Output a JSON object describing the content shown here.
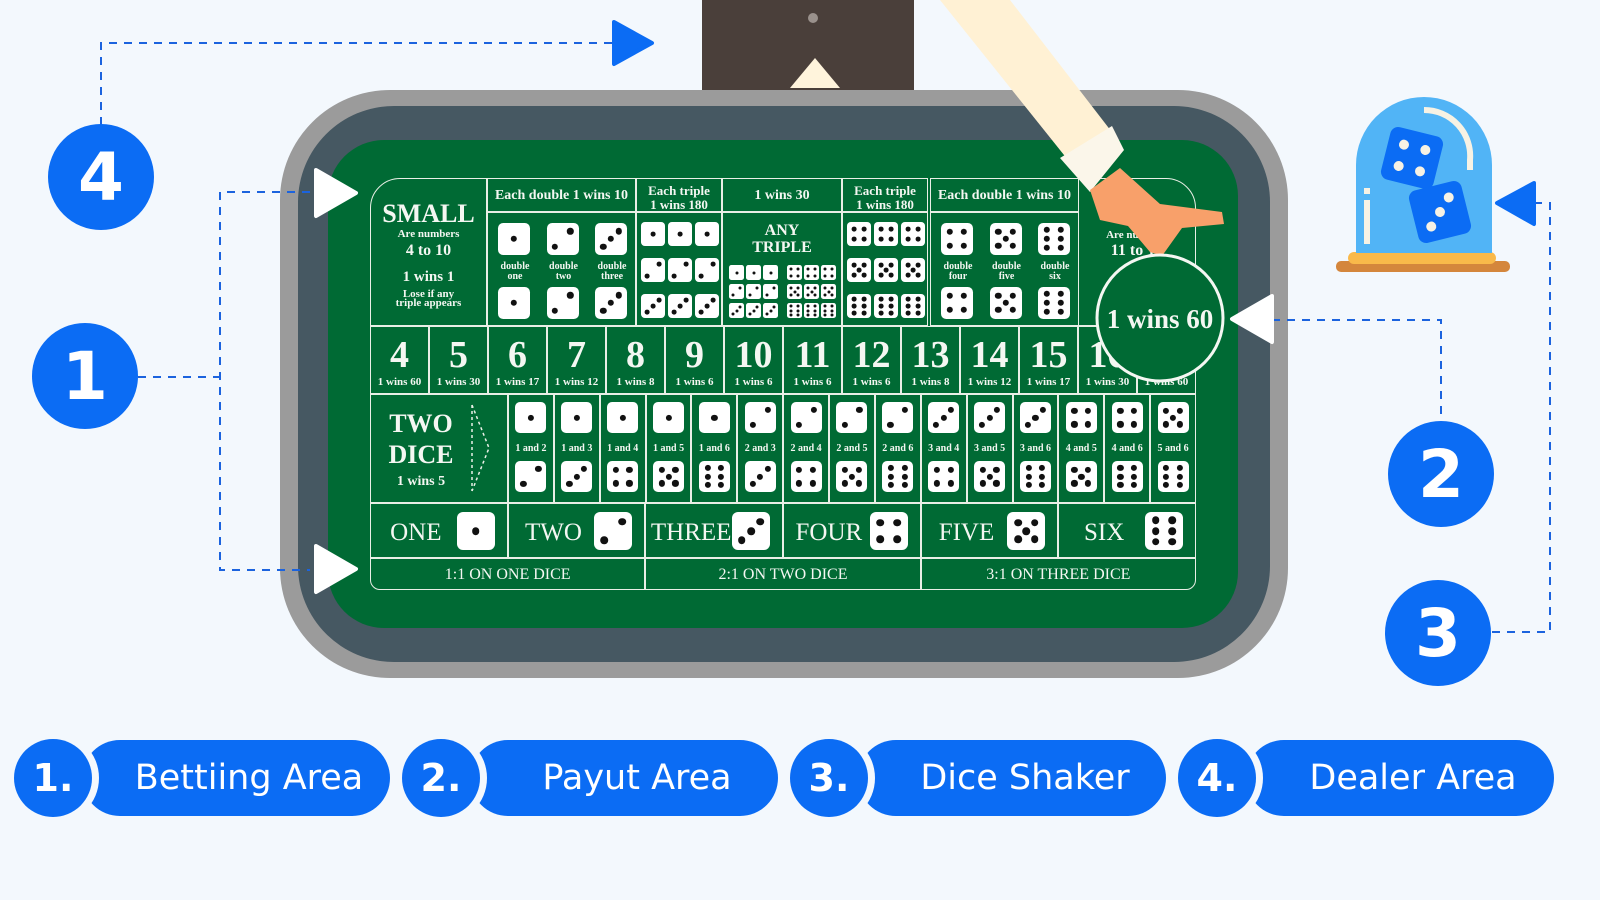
{
  "colors": {
    "accent": "#0b6cf4",
    "felt": "#006a34",
    "rail": "#465862",
    "rim": "#9b9b9b",
    "background": "#f3f8fd"
  },
  "markers": [
    "4",
    "1",
    "2",
    "3"
  ],
  "board": {
    "small": {
      "title": "SMALL",
      "line1": "Are numbers",
      "line2": "4 to 10",
      "line3": "1 wins 1",
      "line4": "Lose if any",
      "line5": "triple appears"
    },
    "big": {
      "line1": "Are numbers",
      "line2": "11 to 17"
    },
    "double_header": "Each double 1 wins 10",
    "triple_header": [
      "Each triple",
      "1 wins 180"
    ],
    "any_header": "1 wins 30",
    "any_label": [
      "ANY",
      "TRIPLE"
    ],
    "doubles_left": [
      {
        "value": 1,
        "label": [
          "double",
          "one"
        ]
      },
      {
        "value": 2,
        "label": [
          "double",
          "two"
        ]
      },
      {
        "value": 3,
        "label": [
          "double",
          "three"
        ]
      }
    ],
    "doubles_right": [
      {
        "value": 4,
        "label": [
          "double",
          "four"
        ]
      },
      {
        "value": 5,
        "label": [
          "double",
          "five"
        ]
      },
      {
        "value": 6,
        "label": [
          "double",
          "six"
        ]
      }
    ],
    "triples_left": [
      1,
      2,
      3
    ],
    "triples_right": [
      4,
      5,
      6
    ],
    "totals": [
      {
        "n": "4",
        "pay": "1 wins 60"
      },
      {
        "n": "5",
        "pay": "1 wins 30"
      },
      {
        "n": "6",
        "pay": "1 wins 17"
      },
      {
        "n": "7",
        "pay": "1 wins 12"
      },
      {
        "n": "8",
        "pay": "1 wins 8"
      },
      {
        "n": "9",
        "pay": "1 wins 6"
      },
      {
        "n": "10",
        "pay": "1 wins 6"
      },
      {
        "n": "11",
        "pay": "1 wins 6"
      },
      {
        "n": "12",
        "pay": "1 wins 6"
      },
      {
        "n": "13",
        "pay": "1 wins 8"
      },
      {
        "n": "14",
        "pay": "1 wins 12"
      },
      {
        "n": "15",
        "pay": "1 wins 17"
      },
      {
        "n": "16",
        "pay": "1 wins 30"
      },
      {
        "n": "17",
        "pay": "1 wins 60"
      }
    ],
    "two_dice": {
      "title": [
        "TWO",
        "DICE"
      ],
      "pay": "1 wins 5",
      "pairs": [
        [
          1,
          2
        ],
        [
          1,
          3
        ],
        [
          1,
          4
        ],
        [
          1,
          5
        ],
        [
          1,
          6
        ],
        [
          2,
          3
        ],
        [
          2,
          4
        ],
        [
          2,
          5
        ],
        [
          2,
          6
        ],
        [
          3,
          4
        ],
        [
          3,
          5
        ],
        [
          3,
          6
        ],
        [
          4,
          5
        ],
        [
          4,
          6
        ],
        [
          5,
          6
        ]
      ]
    },
    "singles": [
      {
        "label": "ONE",
        "value": 1
      },
      {
        "label": "TWO",
        "value": 2
      },
      {
        "label": "THREE",
        "value": 3
      },
      {
        "label": "FOUR",
        "value": 4
      },
      {
        "label": "FIVE",
        "value": 5
      },
      {
        "label": "SIX",
        "value": 6
      }
    ],
    "odds": [
      "1:1 ON ONE DICE",
      "2:1 ON TWO DICE",
      "3:1 ON THREE DICE"
    ],
    "payout_circle": "1 wins 60"
  },
  "legend": [
    {
      "num": "1.",
      "label": "Bettiing Area"
    },
    {
      "num": "2.",
      "label": "Payut Area"
    },
    {
      "num": "3.",
      "label": "Dice Shaker"
    },
    {
      "num": "4.",
      "label": "Dealer Area"
    }
  ]
}
